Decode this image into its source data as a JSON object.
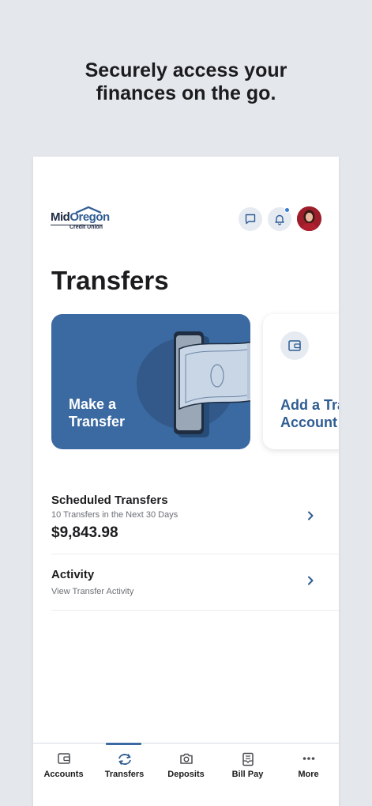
{
  "promo": {
    "headline_line1": "Securely access your",
    "headline_line2": "finances on the go."
  },
  "header": {
    "logo_text_a": "Mid",
    "logo_text_b": "Oregon",
    "logo_subtext": "Credit Union",
    "messages_icon": "chat-bubble-icon",
    "notifications_icon": "bell-icon",
    "has_notification": true
  },
  "page": {
    "title": "Transfers"
  },
  "cards": {
    "primary_line1": "Make a",
    "primary_line2": "Transfer",
    "secondary_line1": "Add a Transfer",
    "secondary_line2": "Account"
  },
  "rows": {
    "scheduled": {
      "title": "Scheduled Transfers",
      "subtitle": "10 Transfers in the Next 30 Days",
      "amount": "$9,843.98"
    },
    "activity": {
      "title": "Activity",
      "subtitle": "View Transfer Activity"
    }
  },
  "tabs": [
    {
      "label": "Accounts",
      "icon": "wallet-icon",
      "active": false
    },
    {
      "label": "Transfers",
      "icon": "transfer-arrows-icon",
      "active": true
    },
    {
      "label": "Deposits",
      "icon": "camera-icon",
      "active": false
    },
    {
      "label": "Bill Pay",
      "icon": "bill-icon",
      "active": false
    },
    {
      "label": "More",
      "icon": "more-dots-icon",
      "active": false
    }
  ],
  "colors": {
    "accent": "#3a6aa1",
    "link": "#2f5d93",
    "background": "#e4e7ec"
  }
}
